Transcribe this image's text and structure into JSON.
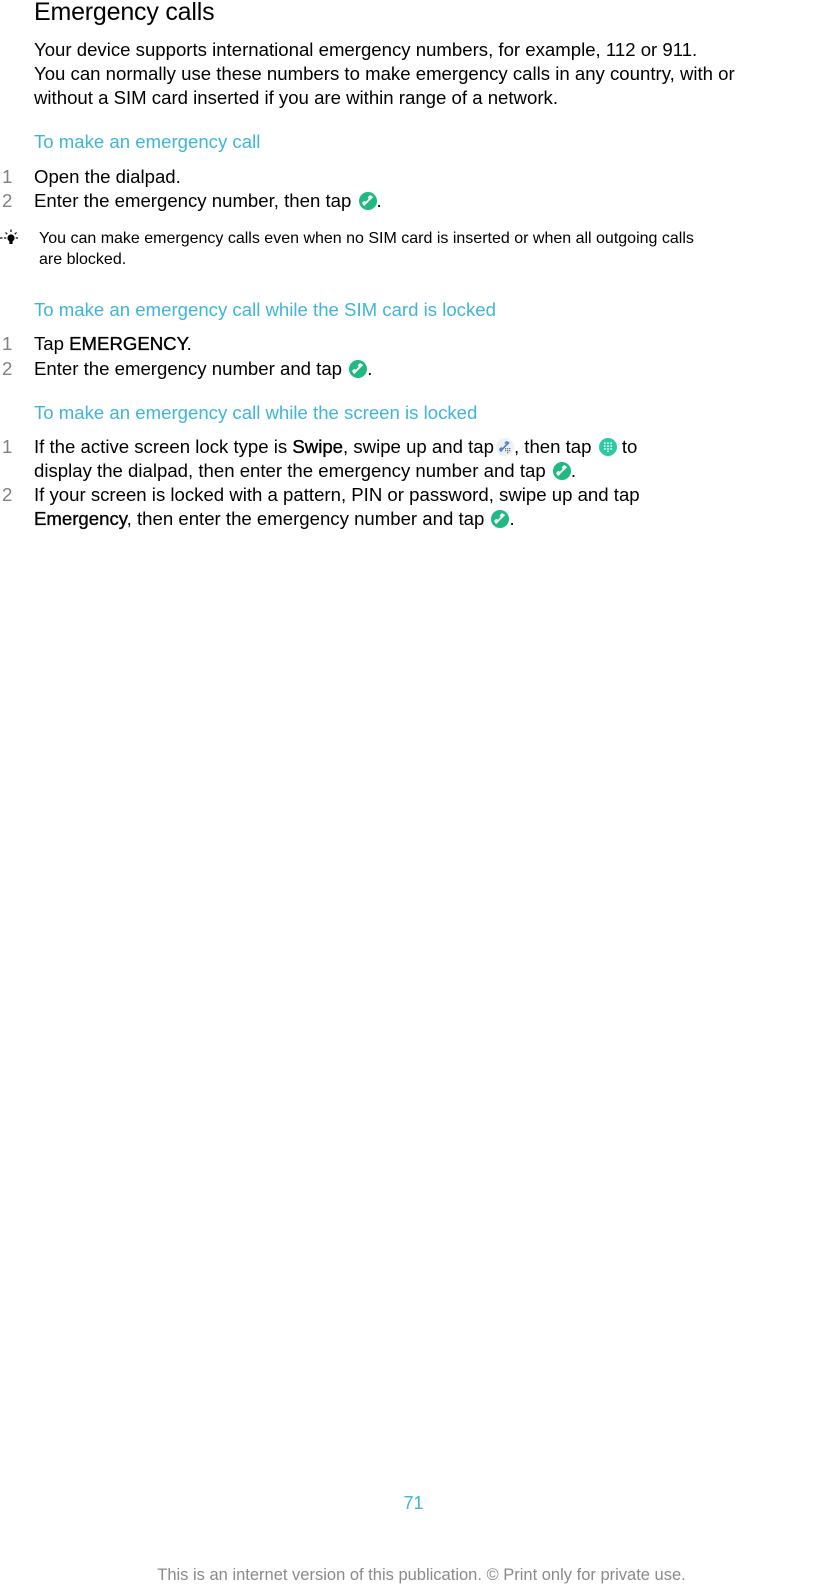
{
  "title": "Emergency calls",
  "intro": "Your device supports international emergency numbers, for example, 112 or 911. You can normally use these numbers to make emergency calls in any country, with or without a SIM card inserted if you are within range of a network.",
  "intro_lines": [
    "Your device supports international emergency numbers, for example, 112 or 911.",
    "You can normally use these numbers to make emergency calls in any country, with or",
    "without a SIM card inserted if you are within range of a network."
  ],
  "sections": [
    {
      "heading": "To make an emergency call",
      "steps": [
        {
          "num": "1",
          "text": "Open the dialpad."
        },
        {
          "num": "2",
          "text_before": "Enter the emergency number, then tap ",
          "icon": "call-icon",
          "text_after": "."
        }
      ],
      "tip": {
        "icon": "lightbulb-icon",
        "lines": [
          "You can make emergency calls even when no SIM card is inserted or when all outgoing calls",
          "are blocked."
        ]
      }
    },
    {
      "heading": "To make an emergency call while the SIM card is locked",
      "steps": [
        {
          "num": "1",
          "text_before": "Tap ",
          "bold": "EMERGENCY",
          "text_after": "."
        },
        {
          "num": "2",
          "text_before": "Enter the emergency number and tap ",
          "icon": "call-icon",
          "text_after": "."
        }
      ]
    },
    {
      "heading": "To make an emergency call while the screen is locked",
      "steps": [
        {
          "num": "1",
          "line1_before": "If the active screen lock type is ",
          "line1_bold": "Swipe",
          "line1_mid": ", swipe up and tap",
          "line1_icon1": "phone-dialpad-icon",
          "line1_mid2": ", then tap ",
          "line1_icon2": "dialpad-icon",
          "line1_after": " to",
          "line2_before": "display the dialpad, then enter the emergency number and tap ",
          "line2_icon": "call-icon",
          "line2_after": "."
        },
        {
          "num": "2",
          "line1": "If your screen is locked with a pattern, PIN or password, swipe up and tap",
          "line2_bold": "Emergency",
          "line2_before": ", then enter the emergency number and tap ",
          "line2_icon": "call-icon",
          "line2_after": "."
        }
      ]
    }
  ],
  "page_number": "71",
  "footer": "This is an internet version of this publication. © Print only for private use.",
  "colors": {
    "heading_accent": "#3fb5d8",
    "step_number": "#808080",
    "call_icon": "#1fb981",
    "dialpad_icon": "#2ec9a5",
    "footer_text": "#8a8a8a"
  }
}
